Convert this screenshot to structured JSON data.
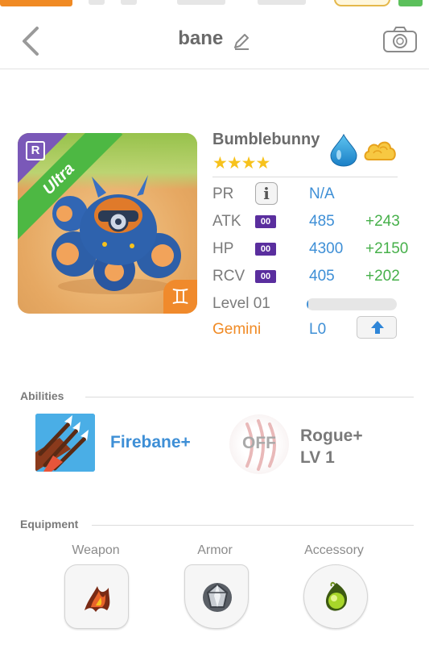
{
  "header": {
    "title": "bane"
  },
  "monster": {
    "name": "Bumblebunny",
    "stars": "★★★★",
    "star_count": 4,
    "rarity_badge": "R",
    "tier_ribbon": "Ultra",
    "zodiac_symbol": "♊",
    "elements": [
      "water-drop-icon",
      "cloud-icon"
    ]
  },
  "stats": {
    "pr": {
      "label": "PR",
      "value": "N/A"
    },
    "atk": {
      "label": "ATK",
      "level_badge": "00",
      "value": "485",
      "bonus": "+243"
    },
    "hp": {
      "label": "HP",
      "level_badge": "00",
      "value": "4300",
      "bonus": "+2150"
    },
    "rcv": {
      "label": "RCV",
      "level_badge": "00",
      "value": "405",
      "bonus": "+202"
    },
    "level": {
      "label": "Level 01",
      "progress": 0.02
    },
    "sign": {
      "label": "Gemini",
      "value": "L0"
    }
  },
  "abilities": {
    "heading": "Abilities",
    "items": [
      {
        "name": "Firebane+",
        "icon": "arrows-icon"
      },
      {
        "name_line1": "Rogue+",
        "name_line2": "LV 1",
        "state": "OFF",
        "icon": "claw-icon"
      }
    ]
  },
  "equipment": {
    "heading": "Equipment",
    "slots": [
      {
        "label": "Weapon",
        "icon": "flame-weapon-icon"
      },
      {
        "label": "Armor",
        "icon": "crystal-armor-icon"
      },
      {
        "label": "Accessory",
        "icon": "green-gem-icon"
      }
    ]
  },
  "colors": {
    "accent_blue": "#3e8fd6",
    "bonus_green": "#46b04a",
    "zodiac_orange": "#f08a24",
    "ultra_green": "#4db843",
    "star_yellow": "#f7c21c",
    "level_badge_purple": "#5a2e9e"
  }
}
